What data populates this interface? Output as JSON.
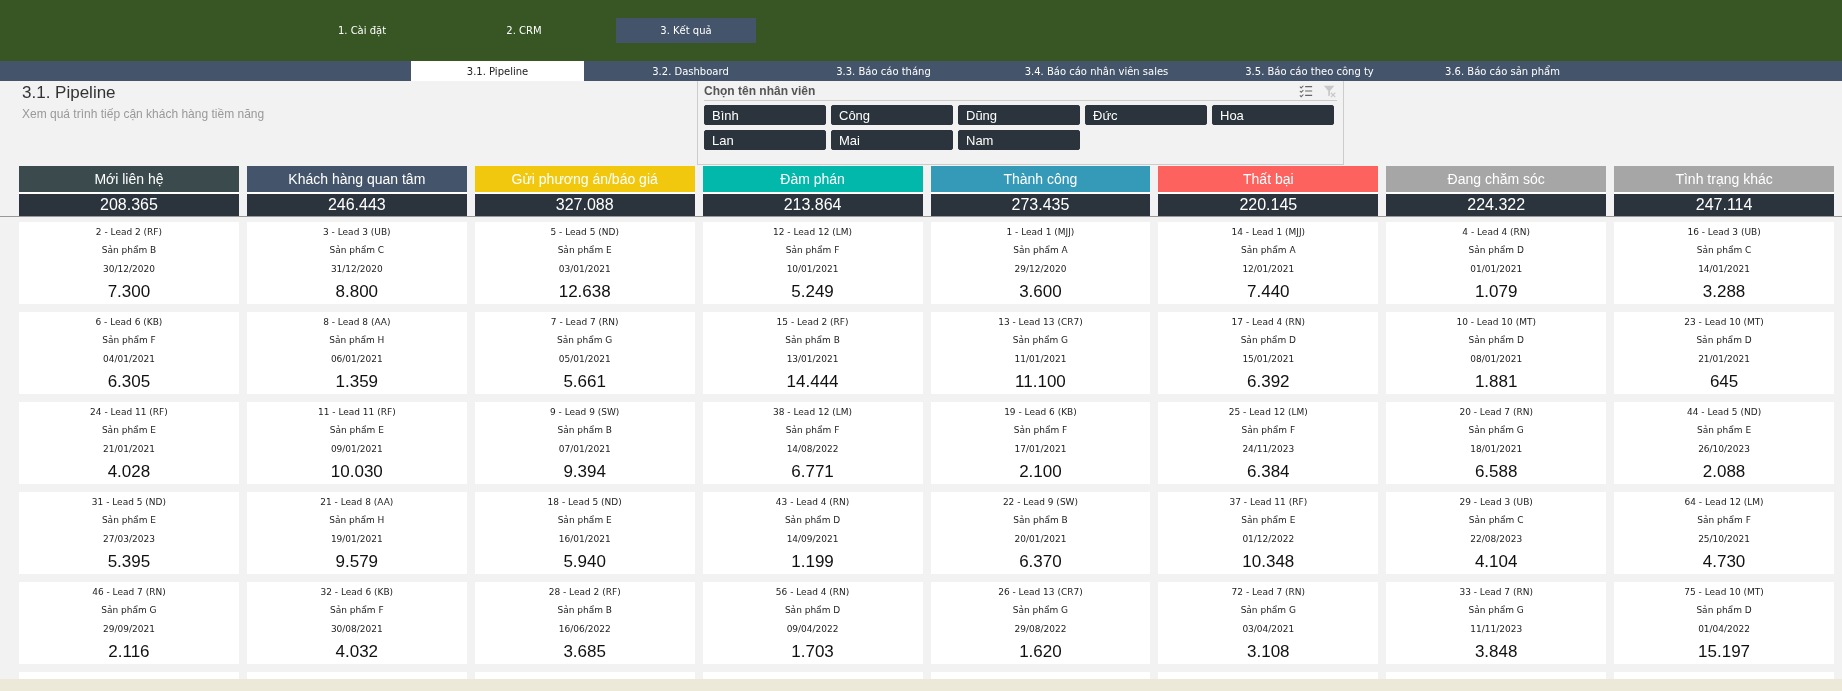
{
  "nav": [
    {
      "label": "1. Cài đặt",
      "selected": false
    },
    {
      "label": "2. CRM",
      "selected": false
    },
    {
      "label": "3. Kết quả",
      "selected": true
    }
  ],
  "tabs": [
    {
      "label": "3.1. Pipeline",
      "selected": true
    },
    {
      "label": "3.2. Dashboard",
      "selected": false
    },
    {
      "label": "3.3. Báo cáo tháng",
      "selected": false
    },
    {
      "label": "3.4. Báo cáo nhân viên sales",
      "selected": false
    },
    {
      "label": "3.5. Báo cáo theo công ty",
      "selected": false
    },
    {
      "label": "3.6. Báo cáo sản phẩm",
      "selected": false
    }
  ],
  "page": {
    "title": "3.1. Pipeline",
    "subtitle": "Xem quá trình tiếp cận khách hàng tiềm năng"
  },
  "slicer": {
    "title": "Chọn tên nhân viên",
    "items": [
      {
        "label": "Bình",
        "selected": true
      },
      {
        "label": "Công",
        "selected": true
      },
      {
        "label": "Dũng",
        "selected": true
      },
      {
        "label": "Đức",
        "selected": true
      },
      {
        "label": "Hoa",
        "selected": true
      },
      {
        "label": "Lan",
        "selected": true
      },
      {
        "label": "Mai",
        "selected": true
      },
      {
        "label": "Nam",
        "selected": true
      }
    ]
  },
  "columns": [
    {
      "title": "Mới liên hệ",
      "color": "#3b4a4c",
      "total": "208.365",
      "cards": [
        {
          "lead": "2 - Lead 2 (RF)",
          "product": "Sản phẩm B",
          "date": "30/12/2020",
          "amount": "7.300"
        },
        {
          "lead": "6 - Lead 6 (KB)",
          "product": "Sản phẩm F",
          "date": "04/01/2021",
          "amount": "6.305"
        },
        {
          "lead": "24 - Lead 11 (RF)",
          "product": "Sản phẩm E",
          "date": "21/01/2021",
          "amount": "4.028"
        },
        {
          "lead": "31 - Lead 5 (ND)",
          "product": "Sản phẩm E",
          "date": "27/03/2023",
          "amount": "5.395"
        },
        {
          "lead": "46 - Lead 7 (RN)",
          "product": "Sản phẩm G",
          "date": "29/09/2021",
          "amount": "2.116"
        }
      ]
    },
    {
      "title": "Khách hàng quan tâm",
      "color": "#44546a",
      "total": "246.443",
      "cards": [
        {
          "lead": "3 - Lead 3 (UB)",
          "product": "Sản phẩm C",
          "date": "31/12/2020",
          "amount": "8.800"
        },
        {
          "lead": "8 - Lead 8 (AA)",
          "product": "Sản phẩm H",
          "date": "06/01/2021",
          "amount": "1.359"
        },
        {
          "lead": "11 - Lead 11 (RF)",
          "product": "Sản phẩm E",
          "date": "09/01/2021",
          "amount": "10.030"
        },
        {
          "lead": "21 - Lead 8 (AA)",
          "product": "Sản phẩm H",
          "date": "19/01/2021",
          "amount": "9.579"
        },
        {
          "lead": "32 - Lead 6 (KB)",
          "product": "Sản phẩm F",
          "date": "30/08/2021",
          "amount": "4.032"
        }
      ]
    },
    {
      "title": "Gửi phương án/báo giá",
      "color": "#f2c80f",
      "total": "327.088",
      "cards": [
        {
          "lead": "5 - Lead 5 (ND)",
          "product": "Sản phẩm E",
          "date": "03/01/2021",
          "amount": "12.638"
        },
        {
          "lead": "7 - Lead 7 (RN)",
          "product": "Sản phẩm G",
          "date": "05/01/2021",
          "amount": "5.661"
        },
        {
          "lead": "9 - Lead 9 (SW)",
          "product": "Sản phẩm B",
          "date": "07/01/2021",
          "amount": "9.394"
        },
        {
          "lead": "18 - Lead 5 (ND)",
          "product": "Sản phẩm E",
          "date": "16/01/2021",
          "amount": "5.940"
        },
        {
          "lead": "28 - Lead 2 (RF)",
          "product": "Sản phẩm B",
          "date": "16/06/2022",
          "amount": "3.685"
        }
      ]
    },
    {
      "title": "Đàm phán",
      "color": "#01b8aa",
      "total": "213.864",
      "cards": [
        {
          "lead": "12 - Lead 12 (LM)",
          "product": "Sản phẩm F",
          "date": "10/01/2021",
          "amount": "5.249"
        },
        {
          "lead": "15 - Lead 2 (RF)",
          "product": "Sản phẩm B",
          "date": "13/01/2021",
          "amount": "14.444"
        },
        {
          "lead": "38 - Lead 12 (LM)",
          "product": "Sản phẩm F",
          "date": "14/08/2022",
          "amount": "6.771"
        },
        {
          "lead": "43 - Lead 4 (RN)",
          "product": "Sản phẩm D",
          "date": "14/09/2021",
          "amount": "1.199"
        },
        {
          "lead": "56 - Lead 4 (RN)",
          "product": "Sản phẩm D",
          "date": "09/04/2022",
          "amount": "1.703"
        }
      ]
    },
    {
      "title": "Thành công",
      "color": "#3599b8",
      "total": "273.435",
      "cards": [
        {
          "lead": "1 - Lead 1 (MJJ)",
          "product": "Sản phẩm A",
          "date": "29/12/2020",
          "amount": "3.600"
        },
        {
          "lead": "13 - Lead 13 (CR7)",
          "product": "Sản phẩm G",
          "date": "11/01/2021",
          "amount": "11.100"
        },
        {
          "lead": "19 - Lead 6 (KB)",
          "product": "Sản phẩm F",
          "date": "17/01/2021",
          "amount": "2.100"
        },
        {
          "lead": "22 - Lead 9 (SW)",
          "product": "Sản phẩm B",
          "date": "20/01/2021",
          "amount": "6.370"
        },
        {
          "lead": "26 - Lead 13 (CR7)",
          "product": "Sản phẩm G",
          "date": "29/08/2022",
          "amount": "1.620"
        }
      ]
    },
    {
      "title": "Thất bại",
      "color": "#fd625e",
      "total": "220.145",
      "cards": [
        {
          "lead": "14 - Lead 1 (MJJ)",
          "product": "Sản phẩm A",
          "date": "12/01/2021",
          "amount": "7.440"
        },
        {
          "lead": "17 - Lead 4 (RN)",
          "product": "Sản phẩm D",
          "date": "15/01/2021",
          "amount": "6.392"
        },
        {
          "lead": "25 - Lead 12 (LM)",
          "product": "Sản phẩm F",
          "date": "24/11/2023",
          "amount": "6.384"
        },
        {
          "lead": "37 - Lead 11 (RF)",
          "product": "Sản phẩm E",
          "date": "01/12/2022",
          "amount": "10.348"
        },
        {
          "lead": "72 - Lead 7 (RN)",
          "product": "Sản phẩm G",
          "date": "03/04/2021",
          "amount": "3.108"
        }
      ]
    },
    {
      "title": "Đang chăm sóc",
      "color": "#a6a6a6",
      "total": "224.322",
      "cards": [
        {
          "lead": "4 - Lead 4 (RN)",
          "product": "Sản phẩm D",
          "date": "01/01/2021",
          "amount": "1.079"
        },
        {
          "lead": "10 - Lead 10 (MT)",
          "product": "Sản phẩm D",
          "date": "08/01/2021",
          "amount": "1.881"
        },
        {
          "lead": "20 - Lead 7 (RN)",
          "product": "Sản phẩm G",
          "date": "18/01/2021",
          "amount": "6.588"
        },
        {
          "lead": "29 - Lead 3 (UB)",
          "product": "Sản phẩm C",
          "date": "22/08/2023",
          "amount": "4.104"
        },
        {
          "lead": "33 - Lead 7 (RN)",
          "product": "Sản phẩm G",
          "date": "11/11/2023",
          "amount": "3.848"
        }
      ]
    },
    {
      "title": "Tình trạng khác",
      "color": "#a6a6a6",
      "total": "247.114",
      "cards": [
        {
          "lead": "16 - Lead 3 (UB)",
          "product": "Sản phẩm C",
          "date": "14/01/2021",
          "amount": "3.288"
        },
        {
          "lead": "23 - Lead 10 (MT)",
          "product": "Sản phẩm D",
          "date": "21/01/2021",
          "amount": "645"
        },
        {
          "lead": "44 - Lead 5 (ND)",
          "product": "Sản phẩm E",
          "date": "26/10/2023",
          "amount": "2.088"
        },
        {
          "lead": "64 - Lead 12 (LM)",
          "product": "Sản phẩm F",
          "date": "25/10/2021",
          "amount": "4.730"
        },
        {
          "lead": "75 - Lead 10 (MT)",
          "product": "Sản phẩm D",
          "date": "01/04/2022",
          "amount": "15.197"
        }
      ]
    }
  ]
}
